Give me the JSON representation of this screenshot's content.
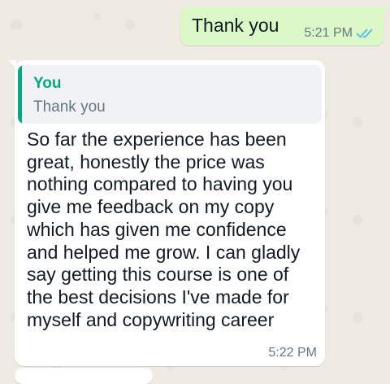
{
  "outgoing_message": {
    "text": "Thank you",
    "time": "5:21 PM",
    "status_icon": "double-check-read-icon",
    "status_color": "#53bdeb"
  },
  "incoming_message": {
    "quote": {
      "author": "You",
      "text": "Thank you",
      "accent_color": "#06a783"
    },
    "body": "So far the experience has been\ngreat, honestly the price was\nnothing compared to having you\ngive me feedback on my copy\nwhich has given me confidence\nand helped me grow. I can gladly\nsay getting this course is one of\nthe best decisions I've made for\nmyself and copywriting career",
    "time": "5:22 PM"
  },
  "colors": {
    "outgoing_bubble": "#dcf8c6",
    "incoming_bubble": "#ffffff",
    "chat_background": "#efeae2"
  }
}
